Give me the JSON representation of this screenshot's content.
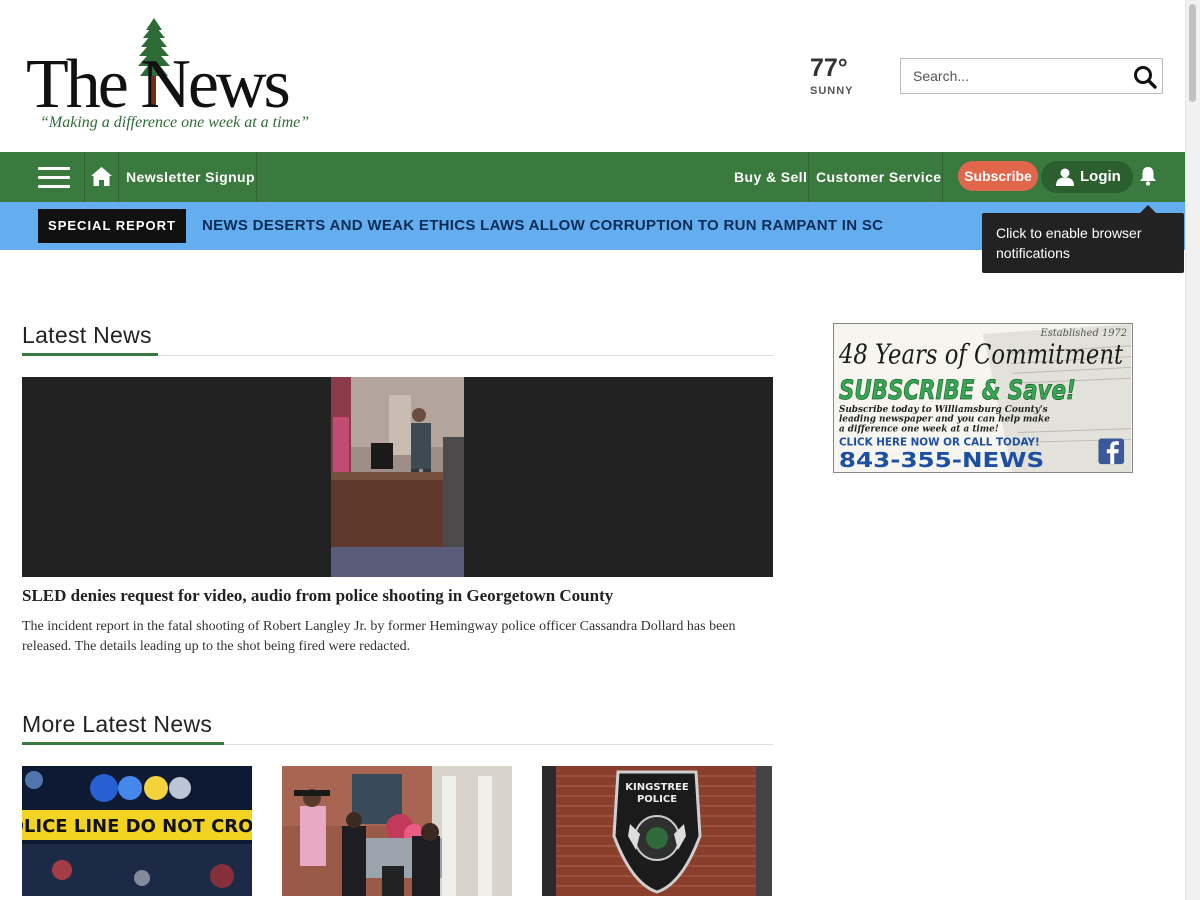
{
  "header": {
    "logo_text": "The News",
    "tagline": "“Making a difference one week at a time”"
  },
  "weather": {
    "temperature": "77°",
    "condition": "SUNNY"
  },
  "search": {
    "placeholder": "Search..."
  },
  "nav": {
    "newsletter_label": "Newsletter Signup",
    "buy_sell_label": "Buy & Sell",
    "customer_service_label": "Customer Service",
    "subscribe_label": "Subscribe",
    "login_label": "Login"
  },
  "special_report": {
    "badge": "SPECIAL REPORT",
    "headline": "NEWS DESERTS AND WEAK ETHICS LAWS ALLOW CORRUPTION TO RUN RAMPANT IN SC"
  },
  "tooltip": {
    "text": "Click to enable browser notifications"
  },
  "latest_news": {
    "title": "Latest News",
    "lead": {
      "headline": "SLED denies request for video, audio from police shooting in Georgetown County",
      "summary": "The incident report in the fatal shooting of Robert Langley Jr. by former Hemingway police officer Cassandra Dollard has been released. The details leading up to the shot being fired were redacted."
    }
  },
  "more_latest_news": {
    "title": "More Latest News",
    "thumb_1_tape": "POLICE LINE DO NOT CROSS",
    "thumb_3_badge_top": "KINGSTREE",
    "thumb_3_badge_mid": "POLICE"
  },
  "ad": {
    "established": "Established 1972",
    "headline": "48 Years of Commitment",
    "subhead": "SUBSCRIBE & Save!",
    "body_line1": "Subscribe today to Williamsburg County's",
    "body_line2": "leading newspaper and you can help make",
    "body_line3": "a difference one week at a time!",
    "cta": "CLICK HERE NOW OR CALL TODAY!",
    "phone": "843-355-NEWS"
  },
  "colors": {
    "nav_green": "#3b7a3e",
    "special_bar_blue": "#64aef0",
    "subscribe_orange": "#e0674b"
  }
}
